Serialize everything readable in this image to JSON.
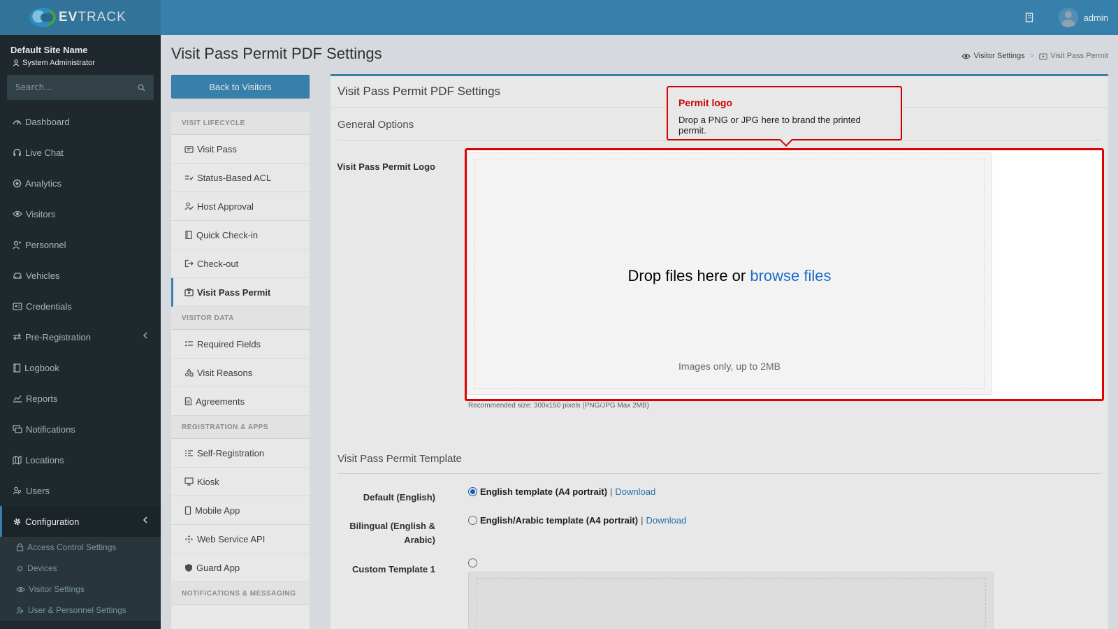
{
  "brand": {
    "logo_bold": "EV",
    "logo_rest": "TRACK"
  },
  "topbar": {
    "user": "admin",
    "notification_icon": "building-icon"
  },
  "sidebar": {
    "site_name": "Default Site Name",
    "role": "System Administrator",
    "search_placeholder": "Search...",
    "items": [
      {
        "label": "Dashboard",
        "icon": "dashboard-icon"
      },
      {
        "label": "Live Chat",
        "icon": "headset-icon"
      },
      {
        "label": "Analytics",
        "icon": "target-icon"
      },
      {
        "label": "Visitors",
        "icon": "eye-icon"
      },
      {
        "label": "Personnel",
        "icon": "user-tie-icon"
      },
      {
        "label": "Vehicles",
        "icon": "car-icon"
      },
      {
        "label": "Credentials",
        "icon": "id-card-icon"
      },
      {
        "label": "Pre-Registration",
        "icon": "exchange-icon"
      },
      {
        "label": "Logbook",
        "icon": "book-icon"
      },
      {
        "label": "Reports",
        "icon": "chart-icon"
      },
      {
        "label": "Notifications",
        "icon": "message-icon"
      },
      {
        "label": "Locations",
        "icon": "map-icon"
      },
      {
        "label": "Users",
        "icon": "users-icon"
      },
      {
        "label": "Configuration",
        "icon": "gear-icon"
      }
    ],
    "sub_items": [
      {
        "label": "Access Control Settings",
        "icon": "lock-icon"
      },
      {
        "label": "Devices",
        "icon": "devices-icon"
      },
      {
        "label": "Visitor Settings",
        "icon": "eye-icon"
      },
      {
        "label": "User & Personnel Settings",
        "icon": "users-icon"
      }
    ]
  },
  "page": {
    "title": "Visit Pass Permit PDF Settings",
    "breadcrumb": [
      "Visitor Settings",
      "Visit Pass Permit"
    ],
    "back_button": "Back to Visitors"
  },
  "settings_nav": {
    "sections": [
      {
        "title": "VISIT LIFECYCLE",
        "items": [
          "Visit Pass",
          "Status-Based ACL",
          "Host Approval",
          "Quick Check-in",
          "Check-out",
          "Visit Pass Permit"
        ]
      },
      {
        "title": "VISITOR DATA",
        "items": [
          "Required Fields",
          "Visit Reasons",
          "Agreements"
        ]
      },
      {
        "title": "REGISTRATION & APPS",
        "items": [
          "Self-Registration",
          "Kiosk",
          "Mobile App",
          "Web Service API",
          "Guard App"
        ]
      },
      {
        "title": "NOTIFICATIONS & MESSAGING",
        "items": []
      }
    ],
    "active": "Visit Pass Permit"
  },
  "panel": {
    "title": "Visit Pass Permit PDF Settings",
    "general_options": "General Options",
    "logo_label": "Visit Pass Permit Logo",
    "dropzone_text": "Drop files here or",
    "dropzone_link": "browse files",
    "dropzone_note": "Images only, up to 2MB",
    "help_text": "Recommended size: 300x150 pixels (PNG/JPG Max 2MB)",
    "template_title": "Visit Pass Permit Template",
    "templates": [
      {
        "label": "Default (English)",
        "option": "English template (A4 portrait)",
        "link": "Download",
        "checked": true
      },
      {
        "label_line1": "Bilingual (English &",
        "label_line2": "Arabic)",
        "option": "English/Arabic template (A4 portrait)",
        "link": "Download",
        "checked": false
      },
      {
        "label": "Custom Template 1",
        "option": "",
        "checked": false
      }
    ]
  },
  "tooltip": {
    "title": "Permit logo",
    "text": "Drop a PNG or JPG here to brand the printed permit."
  },
  "colors": {
    "accent": "#3c8dbc",
    "highlight": "#e00000",
    "sidebar_bg": "#222d32"
  }
}
